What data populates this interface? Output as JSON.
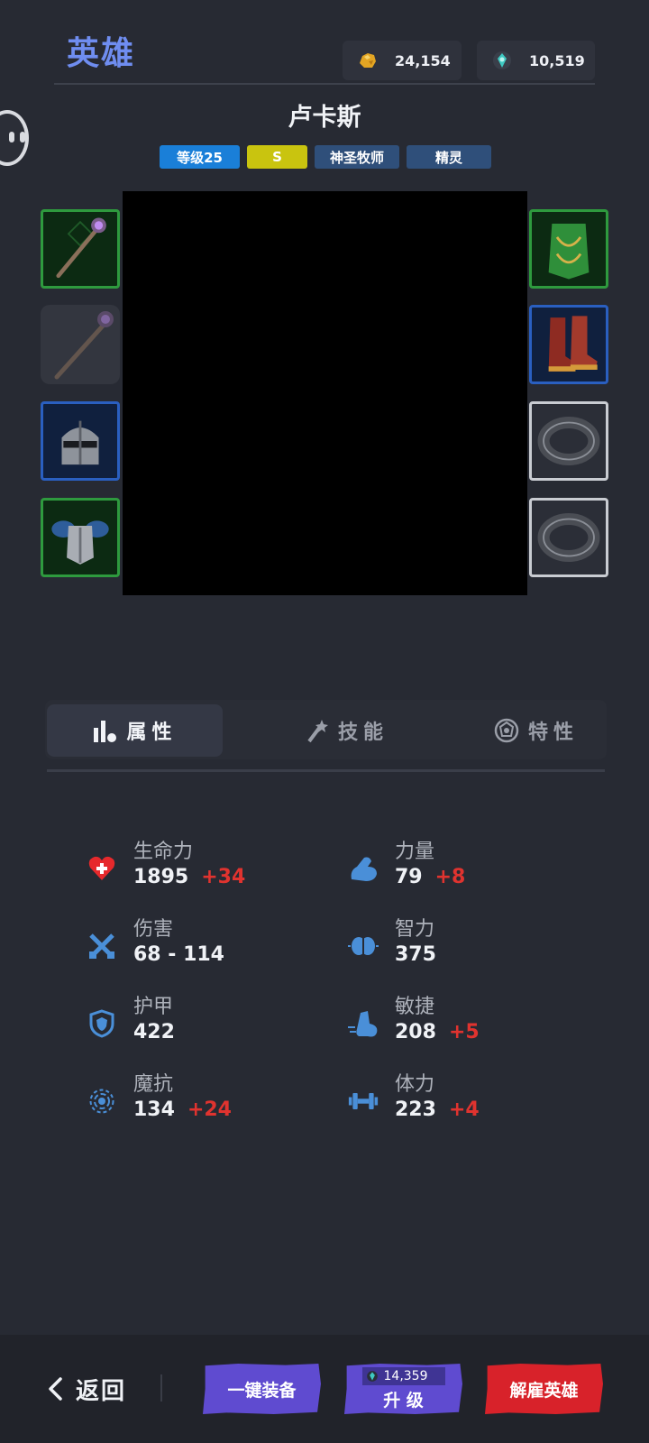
{
  "header": {
    "title": "英雄",
    "gold": "24,154",
    "gems": "10,519",
    "gold_icon": "gold-ore-icon",
    "gem_icon": "soul-gem-icon"
  },
  "hero": {
    "name": "卢卡斯",
    "level_tag": "等级25",
    "rank_tag": "S",
    "class_tag": "神圣牧师",
    "race_tag": "精灵"
  },
  "equipment": {
    "left": [
      {
        "name": "staff",
        "rarity": "green",
        "icon": "staff-icon"
      },
      {
        "name": "staff-offhand",
        "rarity": "empty",
        "icon": "staff-icon"
      },
      {
        "name": "helmet",
        "rarity": "blue",
        "icon": "helmet-icon"
      },
      {
        "name": "armor",
        "rarity": "green",
        "icon": "armor-icon"
      }
    ],
    "right": [
      {
        "name": "cape",
        "rarity": "green",
        "icon": "cape-icon"
      },
      {
        "name": "boots",
        "rarity": "blue",
        "icon": "boots-icon"
      },
      {
        "name": "ring-1",
        "rarity": "white",
        "icon": "ring-icon"
      },
      {
        "name": "ring-2",
        "rarity": "white",
        "icon": "ring-icon"
      }
    ]
  },
  "tabs": {
    "attributes": "属性",
    "skills": "技能",
    "traits": "特性",
    "active": "attributes"
  },
  "stats": {
    "hp": {
      "label": "生命力",
      "value": "1895",
      "bonus": "+34"
    },
    "damage": {
      "label": "伤害",
      "value": "68 - 114",
      "bonus": ""
    },
    "armor": {
      "label": "护甲",
      "value": "422",
      "bonus": ""
    },
    "magic_resist": {
      "label": "魔抗",
      "value": "134",
      "bonus": "+24"
    },
    "strength": {
      "label": "力量",
      "value": "79",
      "bonus": "+8"
    },
    "intellect": {
      "label": "智力",
      "value": "375",
      "bonus": ""
    },
    "agility": {
      "label": "敏捷",
      "value": "208",
      "bonus": "+5"
    },
    "stamina": {
      "label": "体力",
      "value": "223",
      "bonus": "+4"
    }
  },
  "footer": {
    "back": "返回",
    "equip_all": "一键装备",
    "upgrade_cost": "14,359",
    "upgrade": "升 级",
    "dismiss": "解雇英雄"
  },
  "colors": {
    "accent": "#6f8df0",
    "bonus": "#e0332f",
    "button_purple": "#5f4bd0",
    "button_red": "#d8222a"
  }
}
